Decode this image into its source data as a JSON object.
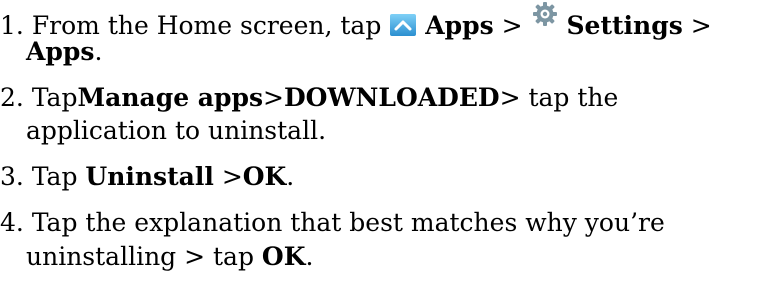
{
  "steps": [
    {
      "num": "1.",
      "lines": [
        {
          "t1": "From the Home screen, tap ",
          "b1": "Apps",
          "t2": " >",
          "b2": " Settings",
          "t3": ">"
        },
        {
          "b1": "Apps",
          "t1": "."
        }
      ]
    },
    {
      "num": "2.",
      "lines": [
        {
          "t1": "Tap",
          "b1": "Manage apps",
          "t2": ">",
          "b2": "DOWNLOADED",
          "t3": "> tap the"
        },
        {
          "t1": "application to uninstall."
        }
      ]
    },
    {
      "num": "3.",
      "lines": [
        {
          "t1": "Tap ",
          "b1": "Uninstall",
          "t2": " >",
          "b2": "OK",
          "t3": "."
        }
      ]
    },
    {
      "num": "4.",
      "lines": [
        {
          "t1": "Tap the explanation that best matches why you’re"
        },
        {
          "t1": "uninstalling > tap ",
          "b1": "OK",
          "t2": "."
        }
      ]
    }
  ],
  "icons": {
    "apps": "apps-chevron-up-icon",
    "settings": "settings-gear-icon",
    "apps_color": "#3aa3e3",
    "settings_color": "#6f8a96"
  }
}
